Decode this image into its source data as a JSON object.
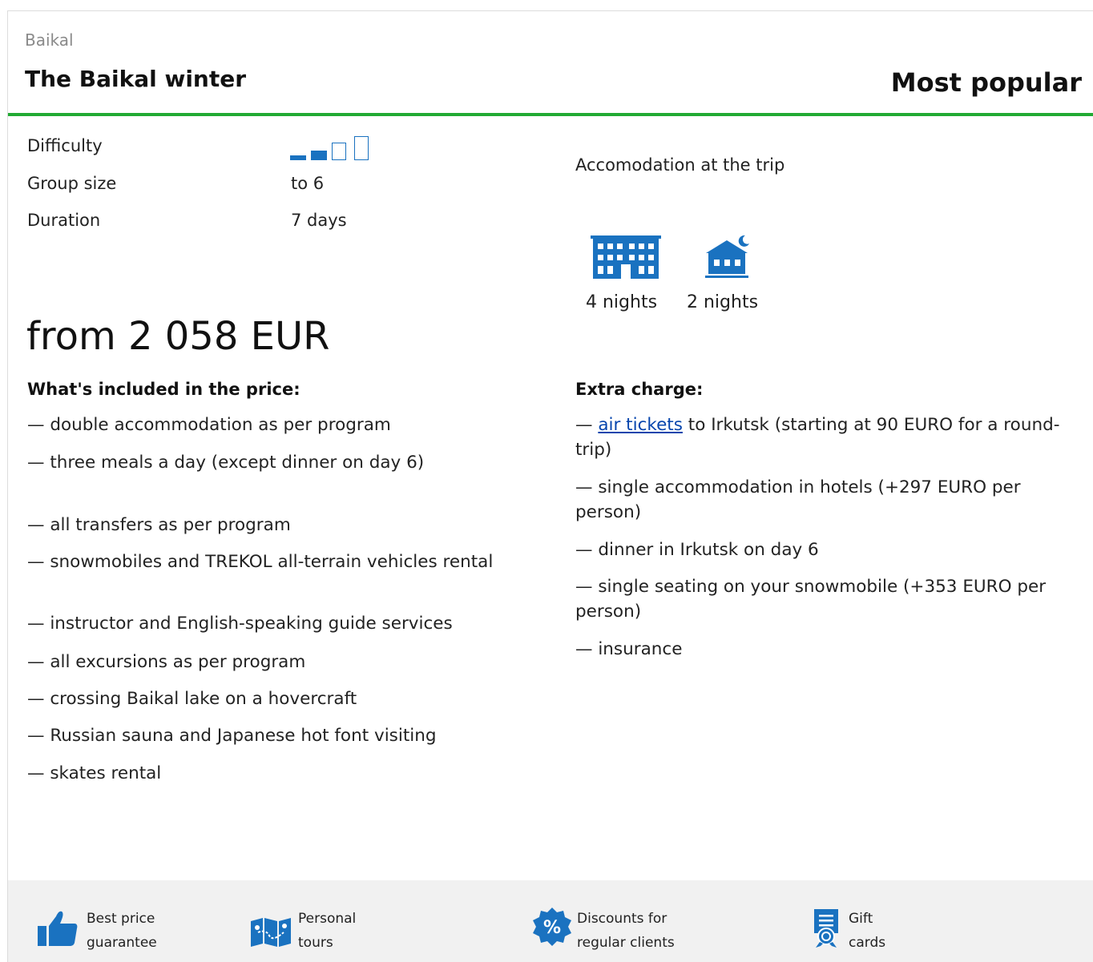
{
  "header": {
    "region": "Baikal",
    "title": "The Baikal winter",
    "badge": "Most popular"
  },
  "params": {
    "difficulty_label": "Difficulty",
    "difficulty_level": 2,
    "difficulty_max": 4,
    "group_label": "Group size",
    "group_value": "to 6",
    "duration_label": "Duration",
    "duration_value": "7 days"
  },
  "accommodation": {
    "title": "Accomodation at the trip",
    "items": [
      {
        "icon": "hotel-icon",
        "nights": "4 nights"
      },
      {
        "icon": "guesthouse-icon",
        "nights": "2 nights"
      }
    ]
  },
  "price": "from 2 058 EUR",
  "included": {
    "heading": "What's included in the price:",
    "items": [
      "— double accommodation as per program",
      "— three meals a day (except dinner on day 6)",
      "— all transfers as per program",
      "— snowmobiles and TREKOL all-terrain vehicles rental",
      "— instructor and English-speaking guide services",
      "— all excursions as per program",
      "— crossing Baikal lake on a hovercraft",
      "— Russian sauna and Japanese hot font visiting",
      "— skates rental"
    ]
  },
  "extra": {
    "heading": "Extra charge:",
    "air_prefix": "— ",
    "air_link": "air tickets",
    "air_rest": " to Irkutsk (starting at 90 EURO for a round-trip)",
    "items": [
      "— single accommodation in hotels (+297 EURO per person)",
      "— dinner in Irkutsk on day 6",
      "— single seating on your snowmobile (+353 EURO per person)",
      "— insurance"
    ]
  },
  "features": [
    {
      "icon": "thumbs-up-icon",
      "line1": "Best price",
      "line2": "guarantee"
    },
    {
      "icon": "map-icon",
      "line1": "Personal",
      "line2": "tours"
    },
    {
      "icon": "discount-badge-icon",
      "line1": "Discounts for",
      "line2": "regular clients"
    },
    {
      "icon": "gift-certificate-icon",
      "line1": "Gift",
      "line2": "cards"
    }
  ],
  "colors": {
    "accent": "#1a72c0",
    "divider": "#22aa33",
    "footer_bg": "#f1f1f1"
  }
}
